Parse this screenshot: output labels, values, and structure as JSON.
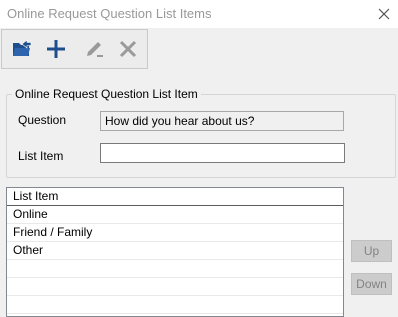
{
  "window": {
    "title": "Online Request Question List Items",
    "close_icon": "close-icon"
  },
  "toolbar": {
    "buttons": [
      {
        "icon": "open-folder-icon",
        "enabled": true
      },
      {
        "icon": "add-icon",
        "enabled": true
      },
      {
        "icon": "edit-pencil-icon",
        "enabled": false
      },
      {
        "icon": "delete-x-icon",
        "enabled": false
      }
    ]
  },
  "group": {
    "legend": "Online Request Question List Item",
    "question_label": "Question",
    "question_value": "How did you hear about us?",
    "list_item_label": "List Item",
    "list_item_value": ""
  },
  "list": {
    "header": "List Item",
    "items": [
      "Online",
      "Friend / Family",
      "Other",
      "",
      "",
      "",
      ""
    ]
  },
  "side_buttons": {
    "up_label": "Up",
    "down_label": "Down"
  },
  "colors": {
    "accent_blue": "#1f4e8c",
    "disabled_gray": "#9a9a9a"
  }
}
